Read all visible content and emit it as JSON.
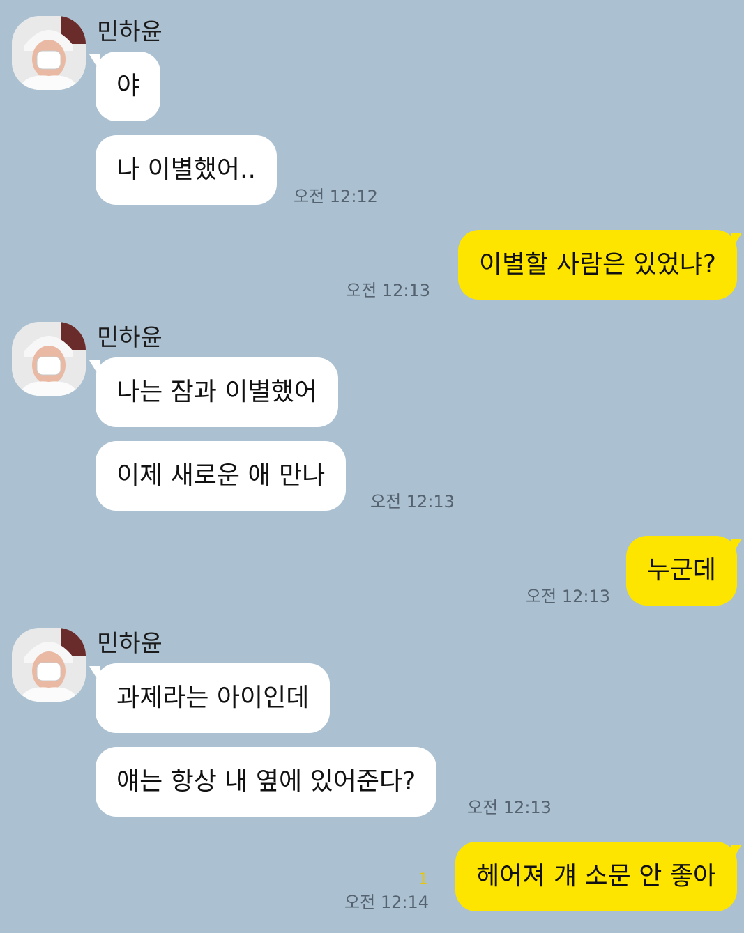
{
  "chat": {
    "sender_name": "민하윤",
    "avatar_icon": "profile-photo-icon",
    "colors": {
      "background": "#abc1d1",
      "incoming_bubble": "#ffffff",
      "outgoing_bubble": "#fee500",
      "timestamp": "#556270",
      "unread": "#e8c600"
    },
    "messages": [
      {
        "text": "야"
      },
      {
        "text": "나 이별했어.."
      },
      {
        "time": "오전 12:12"
      },
      {
        "text": "이별할 사람은 있었냐?"
      },
      {
        "time": "오전 12:13"
      },
      {
        "text": "나는 잠과 이별했어"
      },
      {
        "text": "이제 새로운 애 만나"
      },
      {
        "time": "오전 12:13"
      },
      {
        "text": "누군데"
      },
      {
        "time": "오전 12:13"
      },
      {
        "text": "과제라는 아이인데"
      },
      {
        "text": "얘는 항상 내 옆에 있어준다?"
      },
      {
        "time": "오전 12:13"
      },
      {
        "text": "헤어져 걔 소문 안 좋아"
      },
      {
        "time": "오전 12:14"
      },
      {
        "unread": "1"
      }
    ]
  }
}
